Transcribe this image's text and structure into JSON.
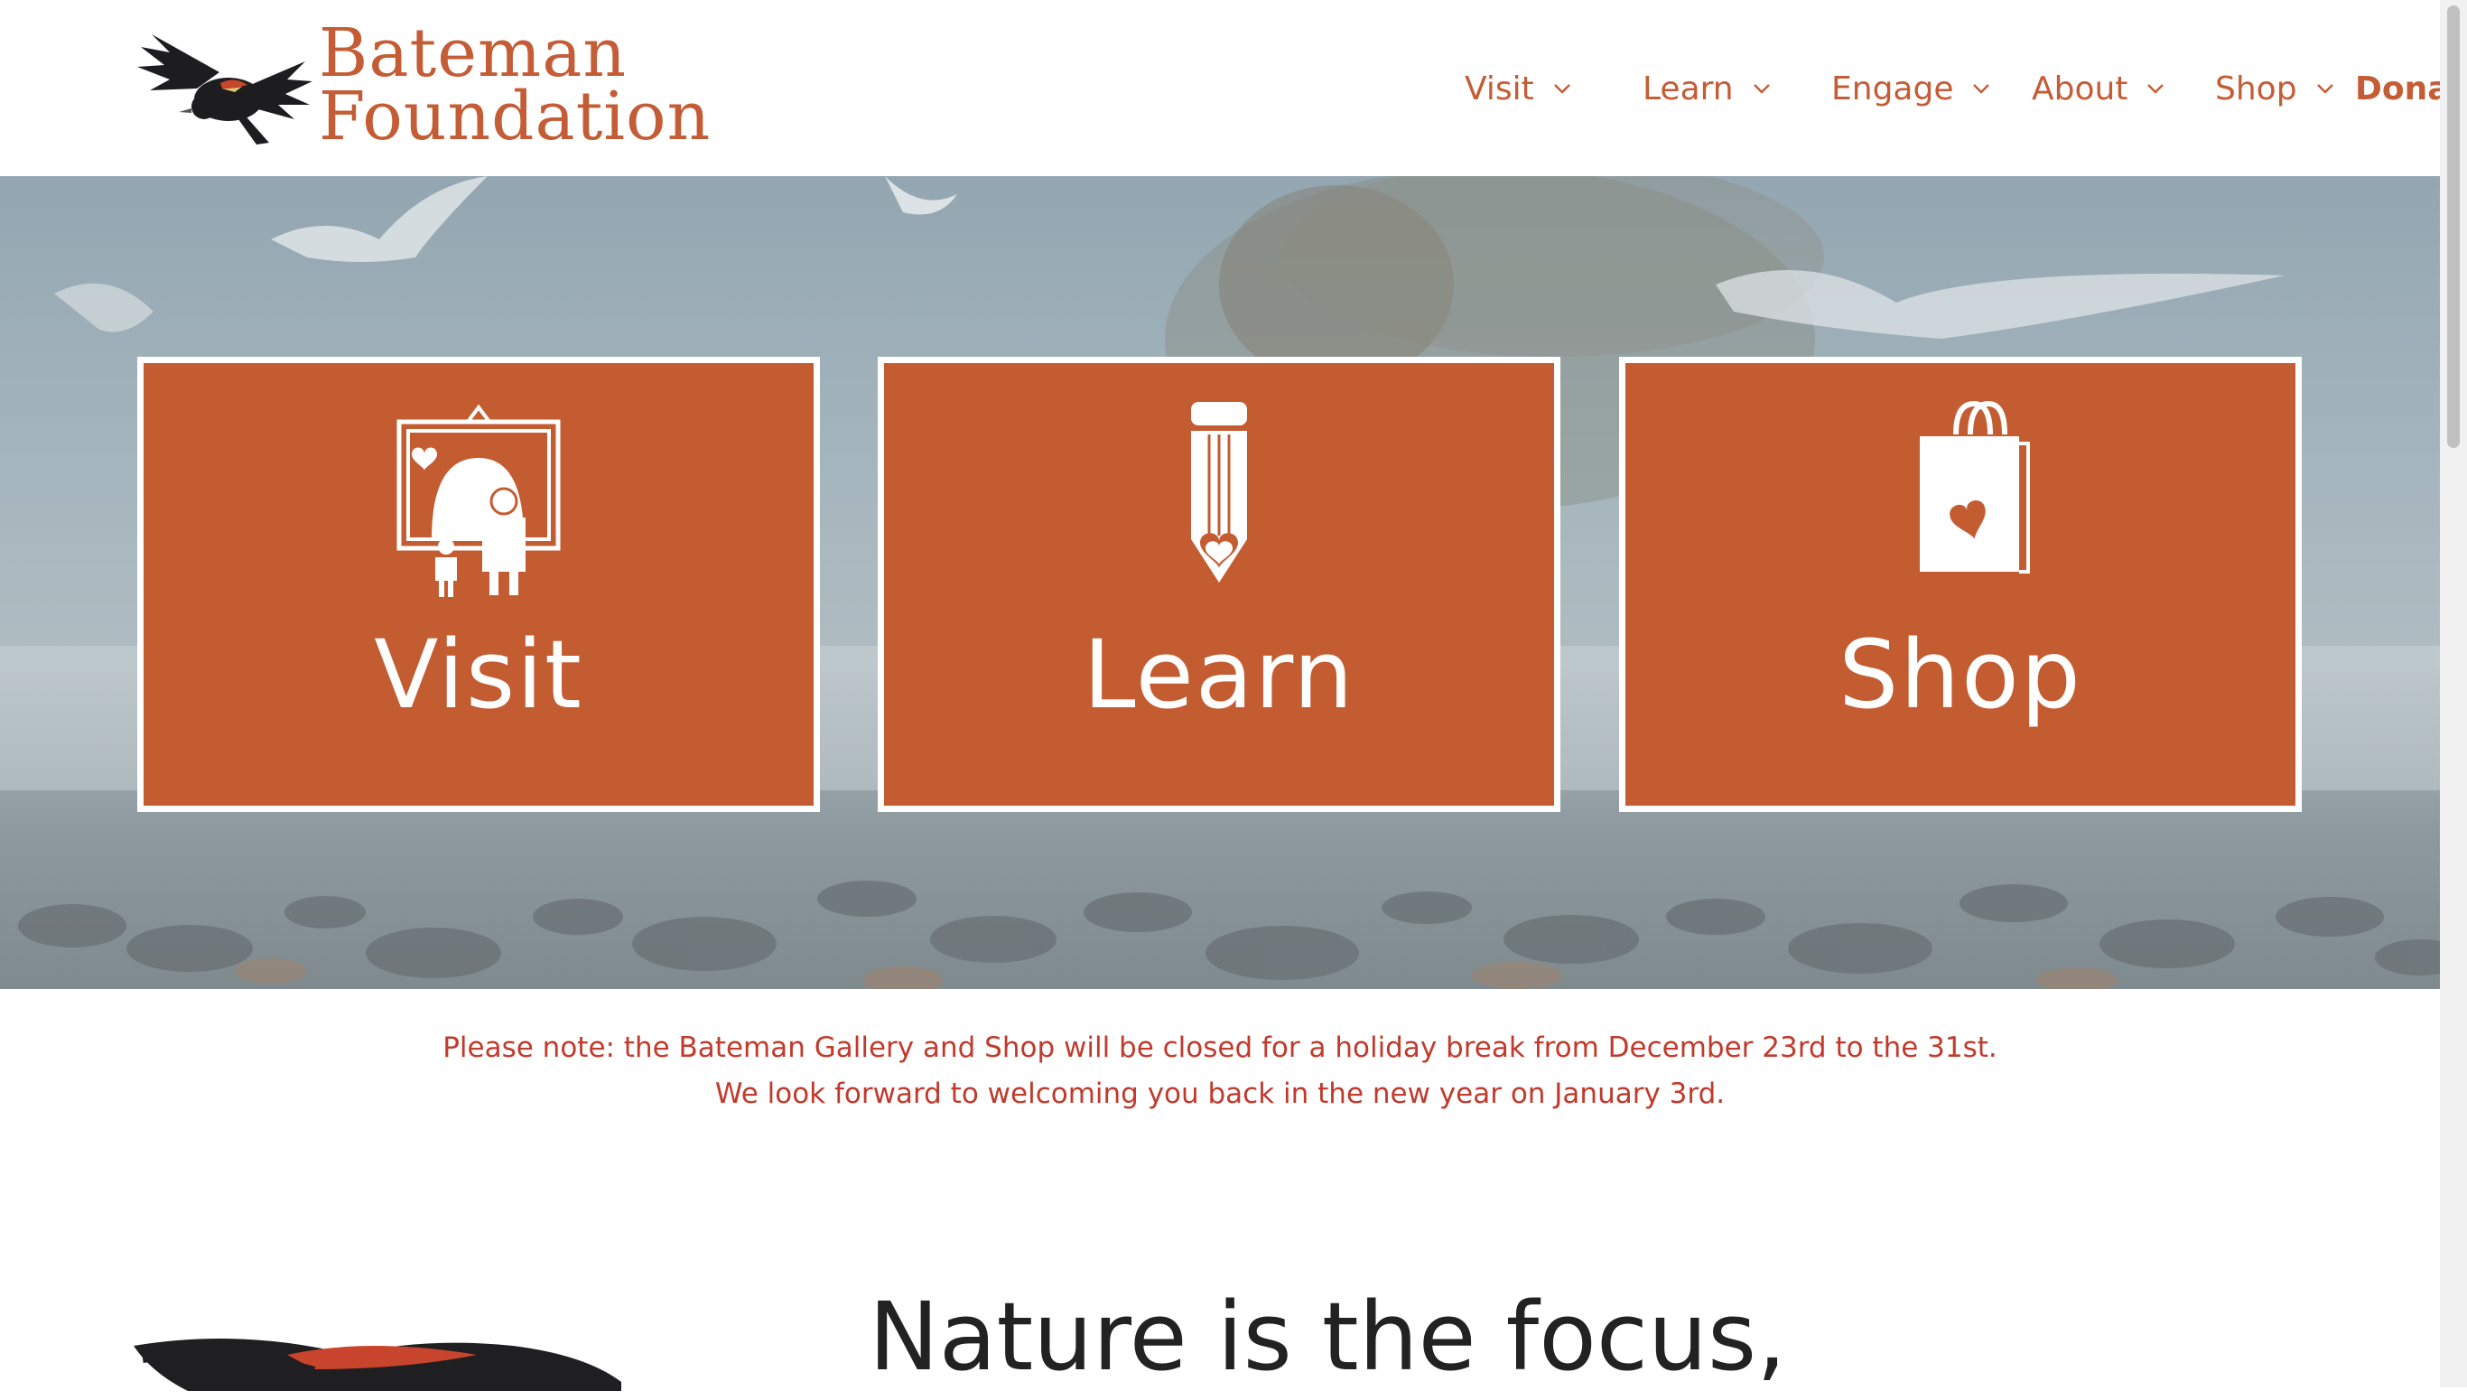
{
  "header": {
    "logo_line1": "Bateman",
    "logo_line2": "Foundation",
    "nav": [
      {
        "label": "Visit"
      },
      {
        "label": "Learn"
      },
      {
        "label": "Engage"
      },
      {
        "label": "About"
      },
      {
        "label": "Shop"
      },
      {
        "label": "Donate"
      }
    ]
  },
  "hero": {
    "tiles": [
      {
        "label": "Visit",
        "icon": "gallery-visitors-icon"
      },
      {
        "label": "Learn",
        "icon": "pencil-heart-icon"
      },
      {
        "label": "Shop",
        "icon": "shopping-bag-heart-icon"
      }
    ]
  },
  "notice": {
    "line1": "Please note: the Bateman Gallery and Shop will be closed for a holiday break from December 23rd to the 31st.",
    "line2": "We look forward to welcoming you back in the new year on January 3rd."
  },
  "intro": {
    "heading": "Nature is the focus,"
  },
  "colors": {
    "brand_orange": "#c45c32",
    "notice_red": "#c13a2c",
    "heading_dark": "#222222"
  }
}
